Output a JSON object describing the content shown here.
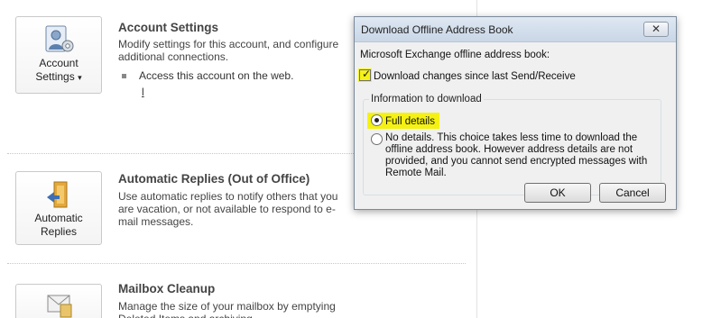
{
  "account": {
    "button_line1": "Account",
    "button_line2": "Settings",
    "dropdown_glyph": "▾",
    "title": "Account Settings",
    "description": "Modify settings for this account, and configure additional connections.",
    "web_access_label": "Access this account on the web.",
    "web_link_text": "l"
  },
  "auto_replies": {
    "button_line1": "Automatic",
    "button_line2": "Replies",
    "title": "Automatic Replies (Out of Office)",
    "description": "Use automatic replies to notify others that you are vacation, or not available to respond to e-mail messages."
  },
  "mailbox_cleanup": {
    "title": "Mailbox Cleanup",
    "description": "Manage the size of your mailbox by emptying Deleted Items and archiving."
  },
  "dialog": {
    "title": "Download Offline Address Book",
    "close_glyph": "✕",
    "label": "Microsoft Exchange offline address book:",
    "download_changes_label": "Download changes since last Send/Receive",
    "download_changes_checked": true,
    "group_label": "Information to download",
    "full_details_label": "Full details",
    "no_details_label": "No details. This choice takes less time to download the offline address book. However address details are not provided, and you cannot send encrypted messages with Remote Mail.",
    "selected_option": "full_details",
    "ok_label": "OK",
    "cancel_label": "Cancel",
    "highlight_color": "#f5f213"
  },
  "icons": [
    "account-settings-icon",
    "automatic-replies-icon",
    "mailbox-cleanup-icon",
    "close-icon",
    "checkbox-icon",
    "radio-icon"
  ]
}
